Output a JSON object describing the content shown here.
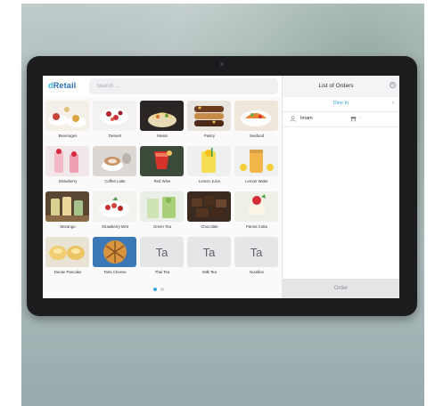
{
  "app": {
    "logo_prefix": "d",
    "logo_main": "Retail"
  },
  "search": {
    "placeholder": "Search ..."
  },
  "categories": [
    {
      "label": "Beverages",
      "thumb": "dessert-plates"
    },
    {
      "label": "Dessert",
      "thumb": "berry-plate"
    },
    {
      "label": "Meats",
      "thumb": "noodle-bowl"
    },
    {
      "label": "Pastry",
      "thumb": "eclair"
    },
    {
      "label": "Seafood",
      "thumb": "seafood-dish"
    },
    {
      "label": "Strawberry",
      "thumb": "strawberry-drink"
    },
    {
      "label": "Coffee Latte",
      "thumb": "latte-cup"
    },
    {
      "label": "Red Wine",
      "thumb": "red-cocktail"
    },
    {
      "label": "Lemon Juice",
      "thumb": "lemon-glass"
    },
    {
      "label": "Lemon Water",
      "thumb": "lemon-jar"
    },
    {
      "label": "Morango",
      "thumb": "green-drinks"
    },
    {
      "label": "Strawberry Mint",
      "thumb": "mint-plate"
    },
    {
      "label": "Green Tea",
      "thumb": "green-tea"
    },
    {
      "label": "Chocolate",
      "thumb": "chocolate"
    },
    {
      "label": "Panna Cotta",
      "thumb": "panna-cotta"
    },
    {
      "label": "Durian Pancake",
      "thumb": "pancake"
    },
    {
      "label": "Tarts Cheese",
      "thumb": "tart-basket"
    },
    {
      "label": "Thai Tea",
      "text": "Ta"
    },
    {
      "label": "Milk Tea",
      "text": "Ta"
    },
    {
      "label": "Noodles",
      "text": "Ta"
    }
  ],
  "orders": {
    "title": "List of Orders",
    "close_icon": "⊘",
    "mode": "Dine In",
    "mode_arrow": "›",
    "customer": "Imam",
    "table": "-",
    "order_button": "Order"
  },
  "pager": {
    "current": 1,
    "total": 2
  },
  "colors": {
    "accent": "#39a9d9",
    "logo": "#2b6fb3"
  }
}
